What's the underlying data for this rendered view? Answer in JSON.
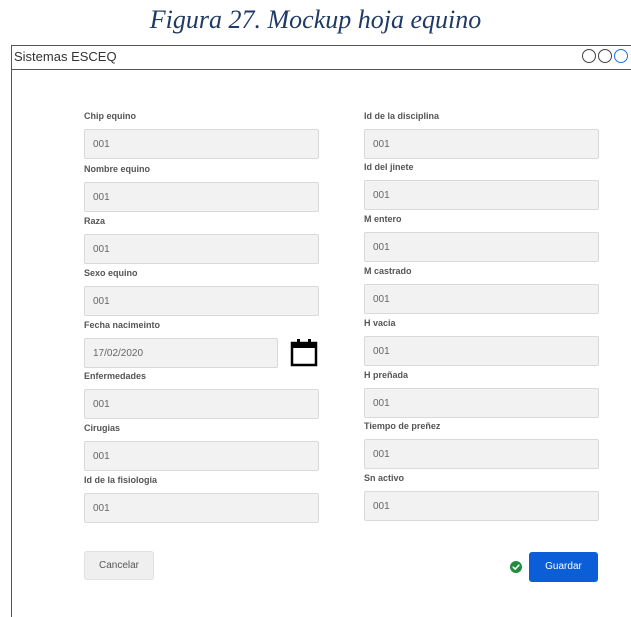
{
  "caption": "Figura 27. Mockup hoja equino",
  "window": {
    "title": "Sistemas ESCEQ"
  },
  "left_column": [
    {
      "label": "Chip equino",
      "value": "001"
    },
    {
      "label": "Nombre equino",
      "value": "001"
    },
    {
      "label": "Raza",
      "value": "001"
    },
    {
      "label": "Sexo equino",
      "value": "001"
    },
    {
      "label": "Fecha nacimeinto",
      "value": "17/02/2020"
    },
    {
      "label": "Enfermedades",
      "value": "001"
    },
    {
      "label": "Cirugias",
      "value": "001"
    },
    {
      "label": "Id de la fisiologia",
      "value": "001"
    }
  ],
  "right_column": [
    {
      "label": "Id de la disciplina",
      "value": "001"
    },
    {
      "label": "Id del jinete",
      "value": "001"
    },
    {
      "label": "M entero",
      "value": "001"
    },
    {
      "label": "M castrado",
      "value": "001"
    },
    {
      "label": "H vacia",
      "value": "001"
    },
    {
      "label": "H preñada",
      "value": "001"
    },
    {
      "label": "Tiempo de preñez",
      "value": "001"
    },
    {
      "label": "Sn activo",
      "value": "001"
    }
  ],
  "actions": {
    "cancel_label": "Cancelar",
    "save_label": "Guardar"
  },
  "icons": {
    "date_picker": "calendar-icon",
    "status": "check-circle-icon"
  },
  "colors": {
    "primary": "#0b5ed7",
    "success": "#1e8e3e",
    "caption": "#1f3b64"
  }
}
